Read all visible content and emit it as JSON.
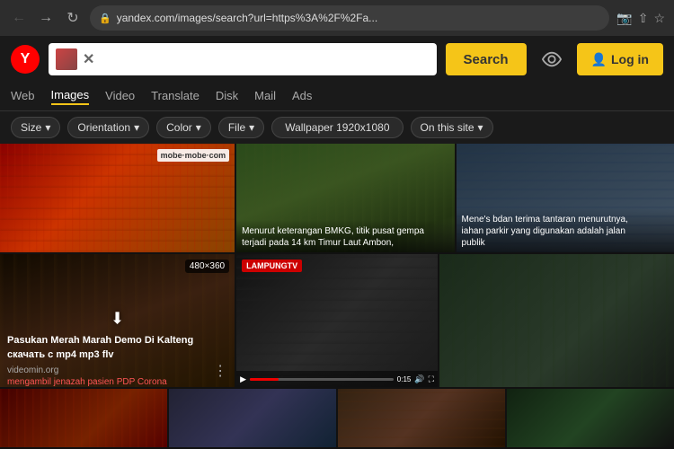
{
  "browser": {
    "url": "yandex.com/images/search?url=https%3A%2F%2Fa...",
    "nav_back": "←",
    "nav_forward": "→",
    "nav_reload": "↻"
  },
  "header": {
    "logo_text": "Y",
    "search_button": "Search",
    "login_button": "Log in",
    "clear_button": "✕"
  },
  "nav": {
    "tabs": [
      "Web",
      "Images",
      "Video",
      "Translate",
      "Disk",
      "Mail",
      "Ads"
    ]
  },
  "filters": {
    "size_label": "Size",
    "orientation_label": "Orientation",
    "color_label": "Color",
    "file_label": "File",
    "wallpaper_label": "Wallpaper 1920x1080",
    "site_label": "On this site"
  },
  "images": {
    "row1": [
      {
        "caption": "",
        "logo": "mobe·mobe·com",
        "bg": "linear-gradient(135deg, #8B0000 0%, #cc3300 40%, #884400 100%)"
      },
      {
        "caption": "Menurut keterangan BMKG, titik pusat gempa\nterjadi pada 14 km Timur Laut Ambon,",
        "bg": "linear-gradient(135deg, #334422 0%, #445533 50%, #223311 100%)"
      },
      {
        "caption": "Mene's bdan terima tantaran menurutnya,\niahan parkir yang digunakan adalah jalan\npublik",
        "bg": "linear-gradient(135deg, #222244 0%, #334455 60%, #445566 100%)"
      }
    ],
    "row2_card": {
      "resolution": "480×360",
      "title": "Pasukan Merah Marah Demo Di Kalteng скачать с mp4 mp3 flv",
      "source": "videomin.org",
      "red_text": "mengambil jenazah pasien PDP Corona",
      "bg": "linear-gradient(135deg, #110a00 0%, #3a2010 50%, #221500 100%)"
    },
    "row2": [
      {
        "caption": "",
        "badge": "LAMPUNGTV",
        "bg": "linear-gradient(135deg, #111 0%, #333 50%, #222 100%)"
      },
      {
        "caption": "",
        "bg": "linear-gradient(135deg, #1a2a1a 0%, #2a3a2a 60%, #151a15 100%)"
      }
    ],
    "row3": [
      {
        "bg": "linear-gradient(135deg, #330000 0%, #662200 60%, #440000 100%)"
      },
      {
        "bg": "linear-gradient(135deg, #222233 0%, #333355 50%, #112233 100%)"
      },
      {
        "bg": "linear-gradient(135deg, #332211 0%, #553322 50%, #221100 100%)"
      },
      {
        "bg": "linear-gradient(135deg, #112211 0%, #224422 50%, #111 100%)"
      }
    ]
  }
}
